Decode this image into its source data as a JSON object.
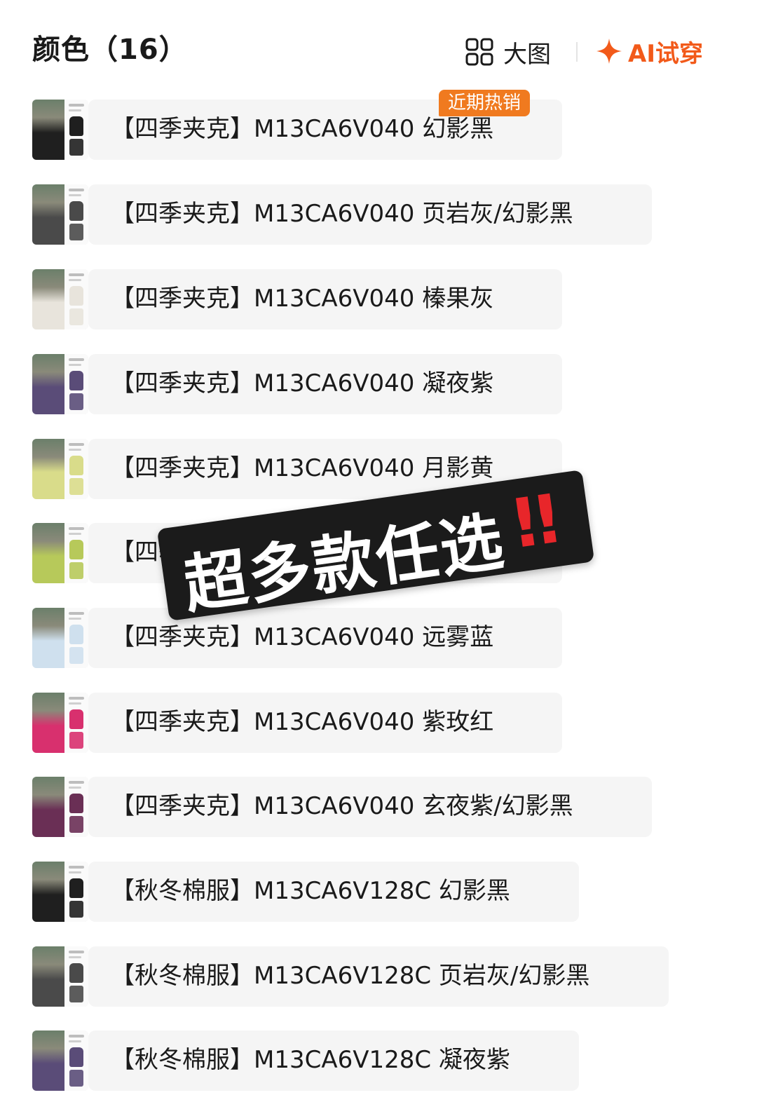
{
  "header": {
    "title": "颜色（16）",
    "big_view_label": "大图",
    "ai_try_label": "AI试穿",
    "accent_color": "#f25a1a"
  },
  "badge": {
    "hot": "近期热销"
  },
  "variants": [
    {
      "label": "【四季夹克】M13CA6V040 幻影黑",
      "color": "#1f1f1f"
    },
    {
      "label": "【四季夹克】M13CA6V040 页岩灰/幻影黑",
      "color": "#4a4a4a"
    },
    {
      "label": "【四季夹克】M13CA6V040 榛果灰",
      "color": "#e8e4dc"
    },
    {
      "label": "【四季夹克】M13CA6V040 凝夜紫",
      "color": "#5a4c78"
    },
    {
      "label": "【四季夹克】M13CA6V040 月影黄",
      "color": "#d9dc8a"
    },
    {
      "label": "【四季夹克】M13CA6V040 青",
      "color": "#b7c95a"
    },
    {
      "label": "【四季夹克】M13CA6V040 远雾蓝",
      "color": "#cfe0ee"
    },
    {
      "label": "【四季夹克】M13CA6V040 紫玫红",
      "color": "#d8306e"
    },
    {
      "label": "【四季夹克】M13CA6V040 玄夜紫/幻影黑",
      "color": "#6a2f55"
    },
    {
      "label": "【秋冬棉服】M13CA6V128C 幻影黑",
      "color": "#1f1f1f"
    },
    {
      "label": "【秋冬棉服】M13CA6V128C 页岩灰/幻影黑",
      "color": "#4a4a4a"
    },
    {
      "label": "【秋冬棉服】M13CA6V128C 凝夜紫",
      "color": "#5a4c78"
    }
  ],
  "overlay": {
    "text": "超多款任选",
    "exclaim": "!!"
  }
}
